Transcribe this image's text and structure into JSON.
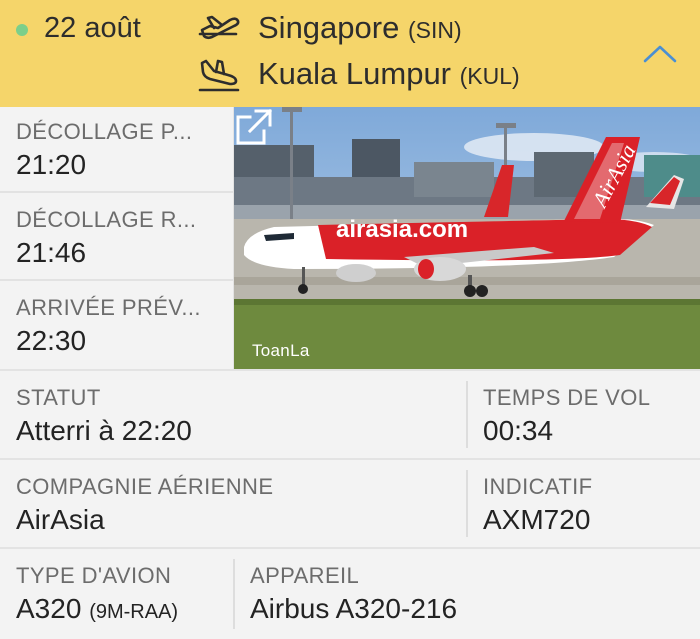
{
  "header": {
    "date": "22 août",
    "departure": {
      "city": "Singapore",
      "code": "(SIN)"
    },
    "arrival": {
      "city": "Kuala Lumpur",
      "code": "(KUL)"
    },
    "colors": {
      "background": "#f5d56a",
      "status_dot": "#7ccf8a",
      "chevron": "#4a8fd3"
    }
  },
  "times": [
    {
      "label": "DÉCOLLAGE P...",
      "value": "21:20"
    },
    {
      "label": "DÉCOLLAGE R...",
      "value": "21:46"
    },
    {
      "label": "ARRIVÉE PRÉV...",
      "value": "22:30"
    }
  ],
  "photo": {
    "credit": "ToanLa",
    "livery_text": "airasia.com",
    "tail_text": "AirAsia"
  },
  "details": {
    "status": {
      "label": "STATUT",
      "value": "Atterri à 22:20"
    },
    "flight_time": {
      "label": "TEMPS DE VOL",
      "value": "00:34"
    },
    "airline": {
      "label": "COMPAGNIE AÉRIENNE",
      "value": "AirAsia"
    },
    "callsign": {
      "label": "INDICATIF",
      "value": "AXM720"
    },
    "aircraft_type": {
      "label": "TYPE D'AVION",
      "value": "A320",
      "registration": "(9M-RAA)"
    },
    "aircraft": {
      "label": "APPAREIL",
      "value": "Airbus A320-216"
    }
  },
  "icons": {
    "departure": "plane-takeoff-icon",
    "arrival": "plane-landing-icon",
    "collapse": "chevron-up-icon",
    "external": "external-link-icon"
  }
}
